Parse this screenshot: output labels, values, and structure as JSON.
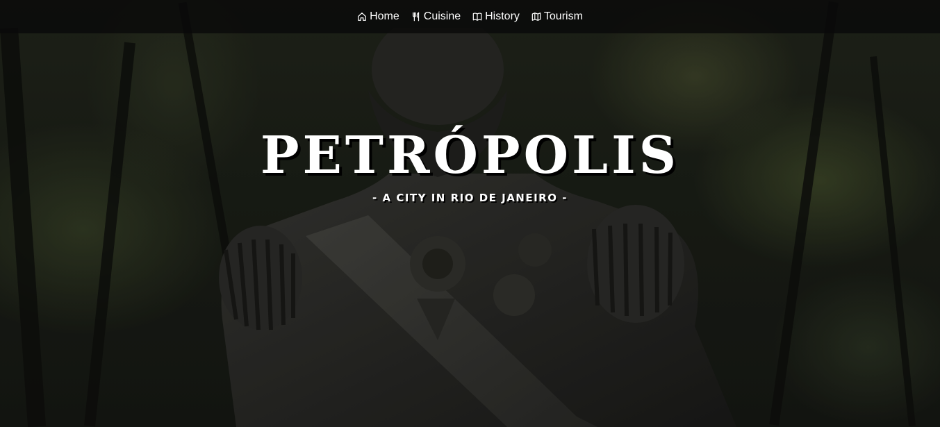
{
  "nav": {
    "items": [
      {
        "label": "Home",
        "icon": "home-icon"
      },
      {
        "label": "Cuisine",
        "icon": "fork-knife-icon"
      },
      {
        "label": "History",
        "icon": "book-icon"
      },
      {
        "label": "Tourism",
        "icon": "map-icon"
      }
    ]
  },
  "hero": {
    "title": "PETRÓPOLIS",
    "subtitle": "- A CITY IN RIO DE JANEIRO -"
  },
  "colors": {
    "nav_background": "#0a0a0a",
    "text": "#ffffff",
    "text_shadow": "#000000"
  }
}
